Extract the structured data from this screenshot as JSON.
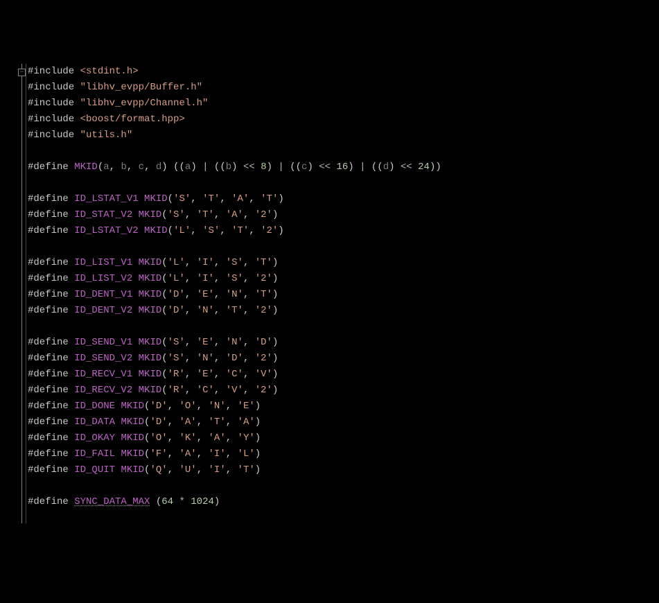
{
  "fold_glyph": "−",
  "lines": [
    [
      {
        "c": "pp",
        "t": "#include "
      },
      {
        "c": "inc",
        "t": "<stdint.h>"
      }
    ],
    [
      {
        "c": "pp",
        "t": "#include "
      },
      {
        "c": "inc",
        "t": "\"libhv_evpp/Buffer.h\""
      }
    ],
    [
      {
        "c": "pp",
        "t": "#include "
      },
      {
        "c": "inc",
        "t": "\"libhv_evpp/Channel.h\""
      }
    ],
    [
      {
        "c": "pp",
        "t": "#include "
      },
      {
        "c": "inc",
        "t": "<boost/format.hpp>"
      }
    ],
    [
      {
        "c": "pp",
        "t": "#include "
      },
      {
        "c": "inc",
        "t": "\"utils.h\""
      }
    ],
    [],
    [
      {
        "c": "pp",
        "t": "#define "
      },
      {
        "c": "macroname",
        "t": "MKID"
      },
      {
        "c": "punct",
        "t": "("
      },
      {
        "c": "param",
        "t": "a"
      },
      {
        "c": "punct",
        "t": ", "
      },
      {
        "c": "param",
        "t": "b"
      },
      {
        "c": "punct",
        "t": ", "
      },
      {
        "c": "param",
        "t": "c"
      },
      {
        "c": "punct",
        "t": ", "
      },
      {
        "c": "param",
        "t": "d"
      },
      {
        "c": "punct",
        "t": ") (("
      },
      {
        "c": "param",
        "t": "a"
      },
      {
        "c": "punct",
        "t": ") "
      },
      {
        "c": "op",
        "t": "|"
      },
      {
        "c": "punct",
        "t": " (("
      },
      {
        "c": "param",
        "t": "b"
      },
      {
        "c": "punct",
        "t": ") "
      },
      {
        "c": "op",
        "t": "<<"
      },
      {
        "c": "punct",
        "t": " "
      },
      {
        "c": "num",
        "t": "8"
      },
      {
        "c": "punct",
        "t": ") "
      },
      {
        "c": "op",
        "t": "|"
      },
      {
        "c": "punct",
        "t": " (("
      },
      {
        "c": "param",
        "t": "c"
      },
      {
        "c": "punct",
        "t": ") "
      },
      {
        "c": "op",
        "t": "<<"
      },
      {
        "c": "punct",
        "t": " "
      },
      {
        "c": "num",
        "t": "16"
      },
      {
        "c": "punct",
        "t": ") "
      },
      {
        "c": "op",
        "t": "|"
      },
      {
        "c": "punct",
        "t": " (("
      },
      {
        "c": "param",
        "t": "d"
      },
      {
        "c": "punct",
        "t": ") "
      },
      {
        "c": "op",
        "t": "<<"
      },
      {
        "c": "punct",
        "t": " "
      },
      {
        "c": "num",
        "t": "24"
      },
      {
        "c": "punct",
        "t": "))"
      }
    ],
    [],
    [
      {
        "c": "pp",
        "t": "#define "
      },
      {
        "c": "macroname",
        "t": "ID_LSTAT_V1"
      },
      {
        "c": "punct",
        "t": " "
      },
      {
        "c": "macroname",
        "t": "MKID"
      },
      {
        "c": "punct",
        "t": "("
      },
      {
        "c": "chr",
        "t": "'S'"
      },
      {
        "c": "punct",
        "t": ", "
      },
      {
        "c": "chr",
        "t": "'T'"
      },
      {
        "c": "punct",
        "t": ", "
      },
      {
        "c": "chr",
        "t": "'A'"
      },
      {
        "c": "punct",
        "t": ", "
      },
      {
        "c": "chr",
        "t": "'T'"
      },
      {
        "c": "punct",
        "t": ")"
      }
    ],
    [
      {
        "c": "pp",
        "t": "#define "
      },
      {
        "c": "macroname",
        "t": "ID_STAT_V2"
      },
      {
        "c": "punct",
        "t": " "
      },
      {
        "c": "macroname",
        "t": "MKID"
      },
      {
        "c": "punct",
        "t": "("
      },
      {
        "c": "chr",
        "t": "'S'"
      },
      {
        "c": "punct",
        "t": ", "
      },
      {
        "c": "chr",
        "t": "'T'"
      },
      {
        "c": "punct",
        "t": ", "
      },
      {
        "c": "chr",
        "t": "'A'"
      },
      {
        "c": "punct",
        "t": ", "
      },
      {
        "c": "chr",
        "t": "'2'"
      },
      {
        "c": "punct",
        "t": ")"
      }
    ],
    [
      {
        "c": "pp",
        "t": "#define "
      },
      {
        "c": "macroname",
        "t": "ID_LSTAT_V2"
      },
      {
        "c": "punct",
        "t": " "
      },
      {
        "c": "macroname",
        "t": "MKID"
      },
      {
        "c": "punct",
        "t": "("
      },
      {
        "c": "chr",
        "t": "'L'"
      },
      {
        "c": "punct",
        "t": ", "
      },
      {
        "c": "chr",
        "t": "'S'"
      },
      {
        "c": "punct",
        "t": ", "
      },
      {
        "c": "chr",
        "t": "'T'"
      },
      {
        "c": "punct",
        "t": ", "
      },
      {
        "c": "chr",
        "t": "'2'"
      },
      {
        "c": "punct",
        "t": ")"
      }
    ],
    [],
    [
      {
        "c": "pp",
        "t": "#define "
      },
      {
        "c": "macroname",
        "t": "ID_LIST_V1"
      },
      {
        "c": "punct",
        "t": " "
      },
      {
        "c": "macroname",
        "t": "MKID"
      },
      {
        "c": "punct",
        "t": "("
      },
      {
        "c": "chr",
        "t": "'L'"
      },
      {
        "c": "punct",
        "t": ", "
      },
      {
        "c": "chr",
        "t": "'I'"
      },
      {
        "c": "punct",
        "t": ", "
      },
      {
        "c": "chr",
        "t": "'S'"
      },
      {
        "c": "punct",
        "t": ", "
      },
      {
        "c": "chr",
        "t": "'T'"
      },
      {
        "c": "punct",
        "t": ")"
      }
    ],
    [
      {
        "c": "pp",
        "t": "#define "
      },
      {
        "c": "macroname",
        "t": "ID_LIST_V2"
      },
      {
        "c": "punct",
        "t": " "
      },
      {
        "c": "macroname",
        "t": "MKID"
      },
      {
        "c": "punct",
        "t": "("
      },
      {
        "c": "chr",
        "t": "'L'"
      },
      {
        "c": "punct",
        "t": ", "
      },
      {
        "c": "chr",
        "t": "'I'"
      },
      {
        "c": "punct",
        "t": ", "
      },
      {
        "c": "chr",
        "t": "'S'"
      },
      {
        "c": "punct",
        "t": ", "
      },
      {
        "c": "chr",
        "t": "'2'"
      },
      {
        "c": "punct",
        "t": ")"
      }
    ],
    [
      {
        "c": "pp",
        "t": "#define "
      },
      {
        "c": "macroname",
        "t": "ID_DENT_V1"
      },
      {
        "c": "punct",
        "t": " "
      },
      {
        "c": "macroname",
        "t": "MKID"
      },
      {
        "c": "punct",
        "t": "("
      },
      {
        "c": "chr",
        "t": "'D'"
      },
      {
        "c": "punct",
        "t": ", "
      },
      {
        "c": "chr",
        "t": "'E'"
      },
      {
        "c": "punct",
        "t": ", "
      },
      {
        "c": "chr",
        "t": "'N'"
      },
      {
        "c": "punct",
        "t": ", "
      },
      {
        "c": "chr",
        "t": "'T'"
      },
      {
        "c": "punct",
        "t": ")"
      }
    ],
    [
      {
        "c": "pp",
        "t": "#define "
      },
      {
        "c": "macroname",
        "t": "ID_DENT_V2"
      },
      {
        "c": "punct",
        "t": " "
      },
      {
        "c": "macroname",
        "t": "MKID"
      },
      {
        "c": "punct",
        "t": "("
      },
      {
        "c": "chr",
        "t": "'D'"
      },
      {
        "c": "punct",
        "t": ", "
      },
      {
        "c": "chr",
        "t": "'N'"
      },
      {
        "c": "punct",
        "t": ", "
      },
      {
        "c": "chr",
        "t": "'T'"
      },
      {
        "c": "punct",
        "t": ", "
      },
      {
        "c": "chr",
        "t": "'2'"
      },
      {
        "c": "punct",
        "t": ")"
      }
    ],
    [],
    [
      {
        "c": "pp",
        "t": "#define "
      },
      {
        "c": "macroname",
        "t": "ID_SEND_V1"
      },
      {
        "c": "punct",
        "t": " "
      },
      {
        "c": "macroname",
        "t": "MKID"
      },
      {
        "c": "punct",
        "t": "("
      },
      {
        "c": "chr",
        "t": "'S'"
      },
      {
        "c": "punct",
        "t": ", "
      },
      {
        "c": "chr",
        "t": "'E'"
      },
      {
        "c": "punct",
        "t": ", "
      },
      {
        "c": "chr",
        "t": "'N'"
      },
      {
        "c": "punct",
        "t": ", "
      },
      {
        "c": "chr",
        "t": "'D'"
      },
      {
        "c": "punct",
        "t": ")"
      }
    ],
    [
      {
        "c": "pp",
        "t": "#define "
      },
      {
        "c": "macroname",
        "t": "ID_SEND_V2"
      },
      {
        "c": "punct",
        "t": " "
      },
      {
        "c": "macroname",
        "t": "MKID"
      },
      {
        "c": "punct",
        "t": "("
      },
      {
        "c": "chr",
        "t": "'S'"
      },
      {
        "c": "punct",
        "t": ", "
      },
      {
        "c": "chr",
        "t": "'N'"
      },
      {
        "c": "punct",
        "t": ", "
      },
      {
        "c": "chr",
        "t": "'D'"
      },
      {
        "c": "punct",
        "t": ", "
      },
      {
        "c": "chr",
        "t": "'2'"
      },
      {
        "c": "punct",
        "t": ")"
      }
    ],
    [
      {
        "c": "pp",
        "t": "#define "
      },
      {
        "c": "macroname",
        "t": "ID_RECV_V1"
      },
      {
        "c": "punct",
        "t": " "
      },
      {
        "c": "macroname",
        "t": "MKID"
      },
      {
        "c": "punct",
        "t": "("
      },
      {
        "c": "chr",
        "t": "'R'"
      },
      {
        "c": "punct",
        "t": ", "
      },
      {
        "c": "chr",
        "t": "'E'"
      },
      {
        "c": "punct",
        "t": ", "
      },
      {
        "c": "chr",
        "t": "'C'"
      },
      {
        "c": "punct",
        "t": ", "
      },
      {
        "c": "chr",
        "t": "'V'"
      },
      {
        "c": "punct",
        "t": ")"
      }
    ],
    [
      {
        "c": "pp",
        "t": "#define "
      },
      {
        "c": "macroname",
        "t": "ID_RECV_V2"
      },
      {
        "c": "punct",
        "t": " "
      },
      {
        "c": "macroname",
        "t": "MKID"
      },
      {
        "c": "punct",
        "t": "("
      },
      {
        "c": "chr",
        "t": "'R'"
      },
      {
        "c": "punct",
        "t": ", "
      },
      {
        "c": "chr",
        "t": "'C'"
      },
      {
        "c": "punct",
        "t": ", "
      },
      {
        "c": "chr",
        "t": "'V'"
      },
      {
        "c": "punct",
        "t": ", "
      },
      {
        "c": "chr",
        "t": "'2'"
      },
      {
        "c": "punct",
        "t": ")"
      }
    ],
    [
      {
        "c": "pp",
        "t": "#define "
      },
      {
        "c": "macroname",
        "t": "ID_DONE"
      },
      {
        "c": "punct",
        "t": " "
      },
      {
        "c": "macroname",
        "t": "MKID"
      },
      {
        "c": "punct",
        "t": "("
      },
      {
        "c": "chr",
        "t": "'D'"
      },
      {
        "c": "punct",
        "t": ", "
      },
      {
        "c": "chr",
        "t": "'O'"
      },
      {
        "c": "punct",
        "t": ", "
      },
      {
        "c": "chr",
        "t": "'N'"
      },
      {
        "c": "punct",
        "t": ", "
      },
      {
        "c": "chr",
        "t": "'E'"
      },
      {
        "c": "punct",
        "t": ")"
      }
    ],
    [
      {
        "c": "pp",
        "t": "#define "
      },
      {
        "c": "macroname",
        "t": "ID_DATA"
      },
      {
        "c": "punct",
        "t": " "
      },
      {
        "c": "macroname",
        "t": "MKID"
      },
      {
        "c": "punct",
        "t": "("
      },
      {
        "c": "chr",
        "t": "'D'"
      },
      {
        "c": "punct",
        "t": ", "
      },
      {
        "c": "chr",
        "t": "'A'"
      },
      {
        "c": "punct",
        "t": ", "
      },
      {
        "c": "chr",
        "t": "'T'"
      },
      {
        "c": "punct",
        "t": ", "
      },
      {
        "c": "chr",
        "t": "'A'"
      },
      {
        "c": "punct",
        "t": ")"
      }
    ],
    [
      {
        "c": "pp",
        "t": "#define "
      },
      {
        "c": "macroname",
        "t": "ID_OKAY"
      },
      {
        "c": "punct",
        "t": " "
      },
      {
        "c": "macroname",
        "t": "MKID"
      },
      {
        "c": "punct",
        "t": "("
      },
      {
        "c": "chr",
        "t": "'O'"
      },
      {
        "c": "punct",
        "t": ", "
      },
      {
        "c": "chr",
        "t": "'K'"
      },
      {
        "c": "punct",
        "t": ", "
      },
      {
        "c": "chr",
        "t": "'A'"
      },
      {
        "c": "punct",
        "t": ", "
      },
      {
        "c": "chr",
        "t": "'Y'"
      },
      {
        "c": "punct",
        "t": ")"
      }
    ],
    [
      {
        "c": "pp",
        "t": "#define "
      },
      {
        "c": "macroname",
        "t": "ID_FAIL"
      },
      {
        "c": "punct",
        "t": " "
      },
      {
        "c": "macroname",
        "t": "MKID"
      },
      {
        "c": "punct",
        "t": "("
      },
      {
        "c": "chr",
        "t": "'F'"
      },
      {
        "c": "punct",
        "t": ", "
      },
      {
        "c": "chr",
        "t": "'A'"
      },
      {
        "c": "punct",
        "t": ", "
      },
      {
        "c": "chr",
        "t": "'I'"
      },
      {
        "c": "punct",
        "t": ", "
      },
      {
        "c": "chr",
        "t": "'L'"
      },
      {
        "c": "punct",
        "t": ")"
      }
    ],
    [
      {
        "c": "pp",
        "t": "#define "
      },
      {
        "c": "macroname",
        "t": "ID_QUIT"
      },
      {
        "c": "punct",
        "t": " "
      },
      {
        "c": "macroname",
        "t": "MKID"
      },
      {
        "c": "punct",
        "t": "("
      },
      {
        "c": "chr",
        "t": "'Q'"
      },
      {
        "c": "punct",
        "t": ", "
      },
      {
        "c": "chr",
        "t": "'U'"
      },
      {
        "c": "punct",
        "t": ", "
      },
      {
        "c": "chr",
        "t": "'I'"
      },
      {
        "c": "punct",
        "t": ", "
      },
      {
        "c": "chr",
        "t": "'T'"
      },
      {
        "c": "punct",
        "t": ")"
      }
    ],
    [],
    [
      {
        "c": "pp",
        "t": "#define "
      },
      {
        "c": "macroname squiggle",
        "t": "SYNC_DATA_MAX"
      },
      {
        "c": "punct",
        "t": " ("
      },
      {
        "c": "num",
        "t": "64"
      },
      {
        "c": "punct",
        "t": " "
      },
      {
        "c": "op",
        "t": "*"
      },
      {
        "c": "punct",
        "t": " "
      },
      {
        "c": "num",
        "t": "1024"
      },
      {
        "c": "punct",
        "t": ")"
      }
    ]
  ]
}
